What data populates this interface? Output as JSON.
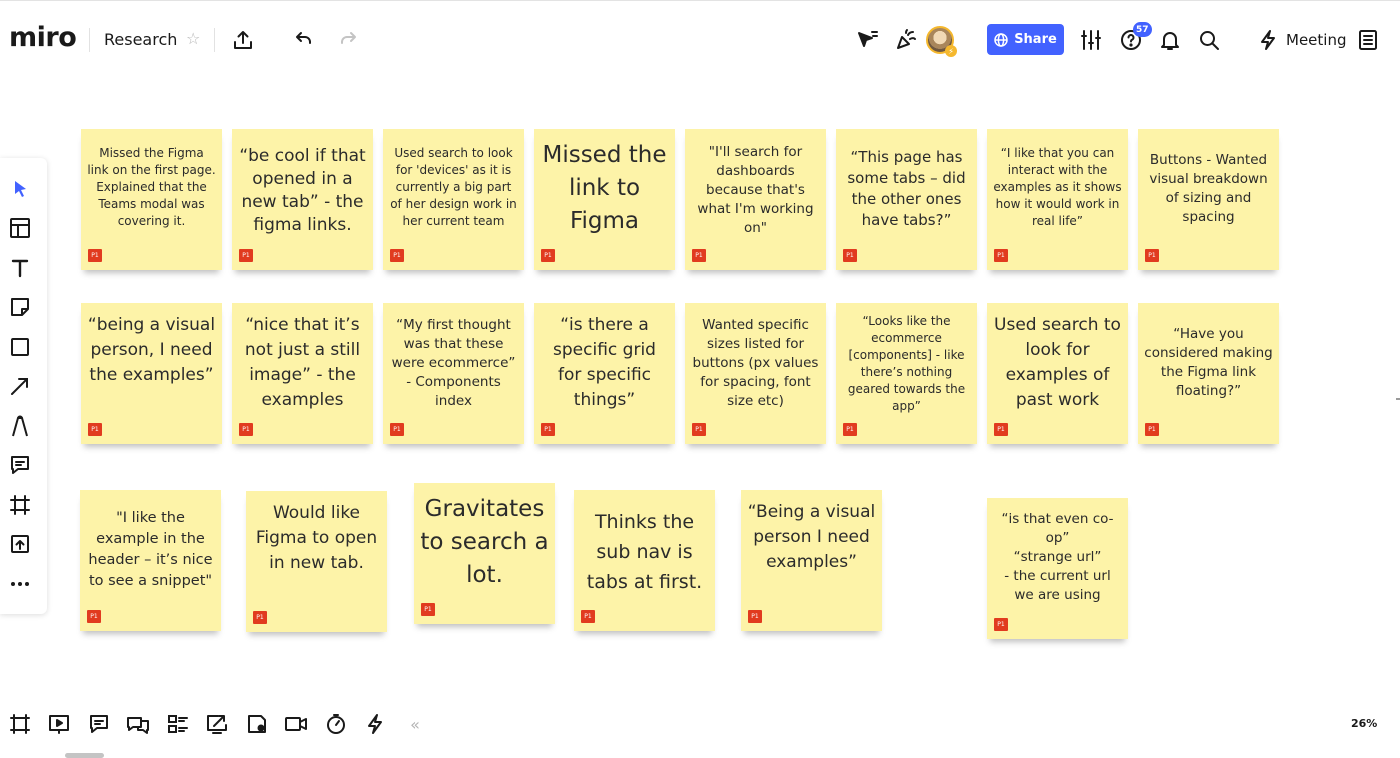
{
  "header": {
    "logo": "miro",
    "board_title": "Research",
    "star_icon": "☆",
    "share_label": "Share",
    "help_badge_count": "57",
    "meeting_label": "Meeting",
    "avatar_badge": "⚡"
  },
  "colors": {
    "sticky": "#fdf3a8",
    "tag": "#e13b1f",
    "share": "#4262ff"
  },
  "stickies": [
    {
      "text": "Missed the Figma link on the first page. Explained that the Teams modal was covering it.",
      "tag": "P1"
    },
    {
      "text": "“be cool if that opened in a new tab” - the figma links.",
      "tag": "P1"
    },
    {
      "text": "Used search to look for 'devices' as it is currently a big part of her design work in her current team",
      "tag": "P1"
    },
    {
      "text": "Missed the link to Figma",
      "tag": "P1"
    },
    {
      "text": "\"I'll search for dashboards because that's what I'm working on\"",
      "tag": "P1"
    },
    {
      "text": "“This page has some tabs – did the other ones have tabs?”",
      "tag": "P1"
    },
    {
      "text": "“I like that you can interact with the examples as it shows how it would work in real life”",
      "tag": "P1"
    },
    {
      "text": "Buttons - Wanted visual breakdown of sizing and spacing",
      "tag": "P1"
    },
    {
      "text": "“being a visual person, I need the examples”",
      "tag": "P1"
    },
    {
      "text": "“nice that it’s not just a still image” - the examples",
      "tag": "P1"
    },
    {
      "text": "“My first thought was that these were ecommerce” - Components index",
      "tag": "P1"
    },
    {
      "text": "“is there a specific grid for specific things”",
      "tag": "P1"
    },
    {
      "text": "Wanted specific sizes listed for buttons (px values for spacing, font size etc)",
      "tag": "P1"
    },
    {
      "text": "“Looks like the ecommerce [components] - like there’s nothing geared towards the app”",
      "tag": "P1"
    },
    {
      "text": "Used search to look for examples of past work",
      "tag": "P1"
    },
    {
      "text": "“Have you considered making the Figma link floating?”",
      "tag": "P1"
    },
    {
      "text": "\"I like the example in the header – it’s nice to see a snippet\"",
      "tag": "P1"
    },
    {
      "text": "Would like Figma to open in new tab.",
      "tag": "P1"
    },
    {
      "text": "Gravitates to search a lot.",
      "tag": "P1"
    },
    {
      "text": "Thinks the sub nav is tabs at first.",
      "tag": "P1"
    },
    {
      "text": "“Being a visual person I need examples”",
      "tag": "P1"
    },
    {
      "text": "“is that even co-op”\n“strange url”\n- the current url we are using",
      "tag": "P1"
    }
  ],
  "footer": {
    "zoom": "26%",
    "collapse_icon": "«"
  }
}
